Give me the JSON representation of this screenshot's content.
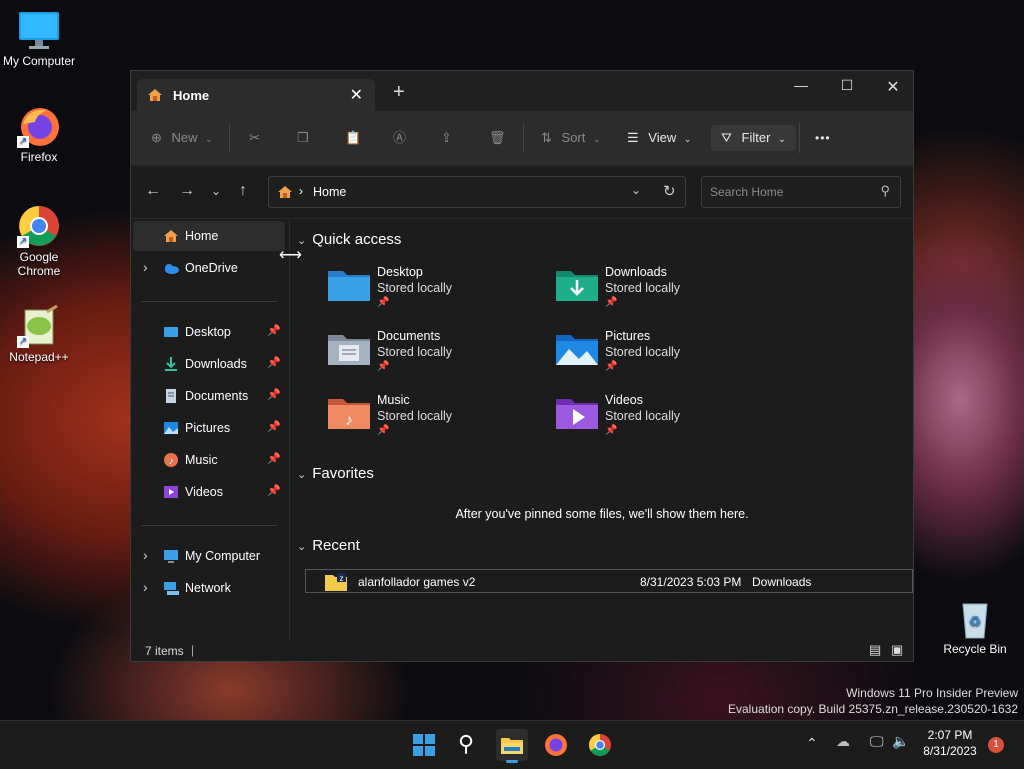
{
  "desktop": {
    "icons": [
      {
        "label": "My Computer"
      },
      {
        "label": "Firefox"
      },
      {
        "label": "Google Chrome"
      },
      {
        "label": "Notepad++"
      },
      {
        "label": "Recycle Bin"
      }
    ],
    "watermark": {
      "line1": "Windows 11 Pro Insider Preview",
      "line2": "Evaluation copy. Build 25375.zn_release.230520-1632"
    }
  },
  "window": {
    "tab_title": "Home",
    "toolbar": {
      "new_label": "New",
      "sort_label": "Sort",
      "view_label": "View",
      "filter_label": "Filter",
      "more_label": "•••"
    },
    "address": {
      "path": "Home"
    },
    "search": {
      "placeholder": "Search Home"
    },
    "nav_pane": {
      "home": "Home",
      "onedrive": "OneDrive",
      "pinned": [
        {
          "label": "Desktop"
        },
        {
          "label": "Downloads"
        },
        {
          "label": "Documents"
        },
        {
          "label": "Pictures"
        },
        {
          "label": "Music"
        },
        {
          "label": "Videos"
        }
      ],
      "my_computer": "My Computer",
      "network": "Network"
    },
    "sections": {
      "quick_access": "Quick access",
      "favorites": "Favorites",
      "favorites_empty": "After you've pinned some files, we'll show them here.",
      "recent": "Recent"
    },
    "quick_access_items": [
      {
        "name": "Desktop",
        "status": "Stored locally"
      },
      {
        "name": "Downloads",
        "status": "Stored locally"
      },
      {
        "name": "Documents",
        "status": "Stored locally"
      },
      {
        "name": "Pictures",
        "status": "Stored locally"
      },
      {
        "name": "Music",
        "status": "Stored locally"
      },
      {
        "name": "Videos",
        "status": "Stored locally"
      }
    ],
    "recent_items": [
      {
        "name": "alanfollador games v2",
        "date": "8/31/2023 5:03 PM",
        "location": "Downloads"
      }
    ],
    "status_bar": {
      "count": "7 items"
    }
  },
  "taskbar": {
    "time": "2:07 PM",
    "date": "8/31/2023",
    "notification_count": "1"
  },
  "colors": {
    "folder_yellow": "#f3c94a",
    "accent_blue": "#3aa0e6",
    "window_bg": "#1c1c1c"
  }
}
